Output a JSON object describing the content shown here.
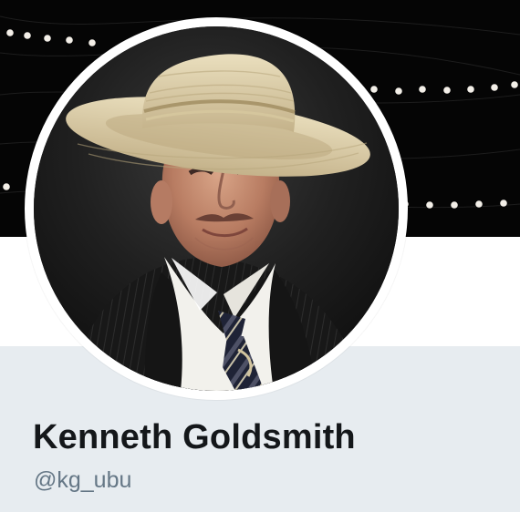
{
  "profile": {
    "display_name": "Kenneth Goldsmith",
    "handle": "@kg_ubu"
  },
  "colors": {
    "banner_background": "#050505",
    "info_background": "#e7ecf0",
    "name_color": "#14171a",
    "handle_color": "#657786"
  },
  "icons": {
    "banner": "dotted-lights-banner",
    "avatar": "man-in-straw-hat-avatar"
  }
}
